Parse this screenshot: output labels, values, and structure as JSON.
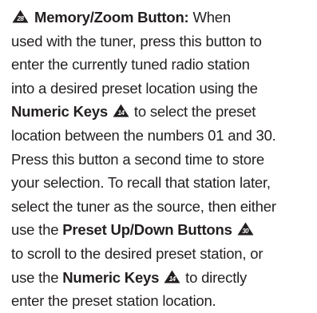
{
  "callouts": {
    "main": "28",
    "numeric_1": "14",
    "preset": "30",
    "numeric_2": "14"
  },
  "content": {
    "heading": "Memory/Zoom Button:",
    "l1_tail": " When",
    "l2": "used with the tuner, press this button to",
    "l3": "enter the currently tuned radio station",
    "l4": "into a desired preset location using the",
    "l5_bold": "Numeric Keys",
    "l5_tail": " to select the preset",
    "l6": "location between the numbers 01 and 30.",
    "l7": "Press this button a second time to store",
    "l8": "your selection. To recall that station later,",
    "l9": "select the tuner as the source, then either",
    "l10_head": "use the ",
    "l10_bold": "Preset Up/Down Buttons",
    "l11": "to scroll to the desired preset station, or",
    "l12_head": "use the ",
    "l12_bold": "Numeric Keys",
    "l12_tail": " to directly",
    "l13": "enter the preset station location."
  },
  "colors": {
    "text": "#231f20",
    "callout_fill": "#231f20"
  }
}
